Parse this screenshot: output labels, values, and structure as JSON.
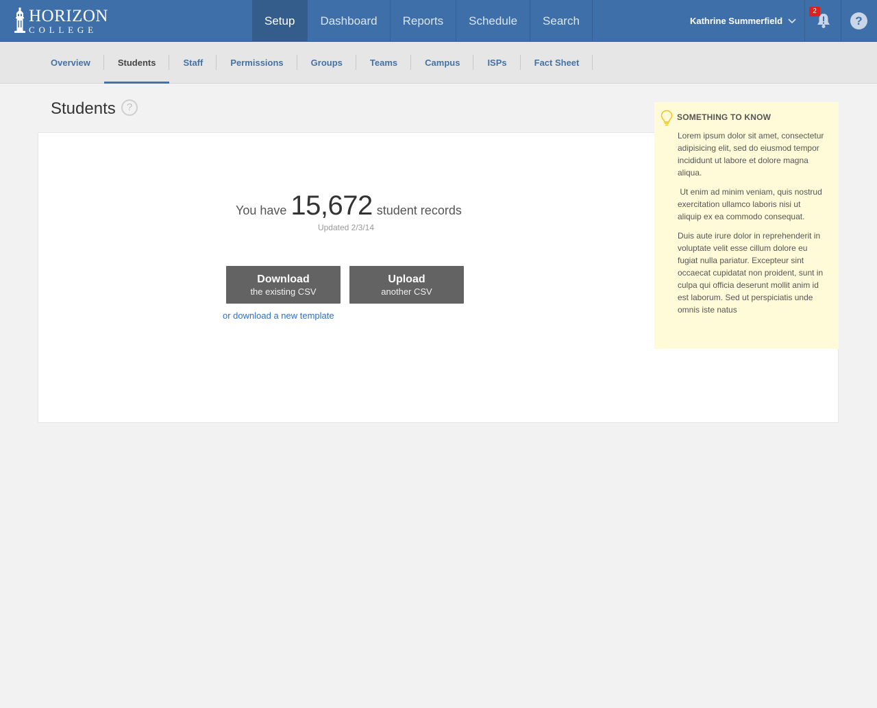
{
  "brand": {
    "line1": "HORIZON",
    "line2": "COLLEGE"
  },
  "main_nav": [
    {
      "label": "Setup",
      "active": true
    },
    {
      "label": "Dashboard",
      "active": false
    },
    {
      "label": "Reports",
      "active": false
    },
    {
      "label": "Schedule",
      "active": false
    },
    {
      "label": "Search",
      "active": false
    }
  ],
  "user": {
    "name": "Kathrine Summerfield",
    "icon": "chevron-down-icon"
  },
  "notifications": {
    "count": "2",
    "icon": "bell-icon"
  },
  "help": {
    "label": "?",
    "icon": "help-icon"
  },
  "sub_nav": [
    {
      "label": "Overview",
      "active": false
    },
    {
      "label": "Students",
      "active": true
    },
    {
      "label": "Staff",
      "active": false
    },
    {
      "label": "Permissions",
      "active": false
    },
    {
      "label": "Groups",
      "active": false
    },
    {
      "label": "Teams",
      "active": false
    },
    {
      "label": "Campus",
      "active": false
    },
    {
      "label": "ISPs",
      "active": false
    },
    {
      "label": "Fact Sheet",
      "active": false
    }
  ],
  "page": {
    "title": "Students",
    "help_label": "?",
    "records_pre": "You have",
    "records_count": "15,672",
    "records_post": "student records",
    "updated": "Updated 2/3/14",
    "download_btn": {
      "line1": "Download",
      "line2": "the existing CSV"
    },
    "upload_btn": {
      "line1": "Upload",
      "line2": "another CSV"
    },
    "template_link": "or download a new template"
  },
  "tip": {
    "icon": "lightbulb-icon",
    "heading": "SOMETHING TO KNOW",
    "paragraphs": [
      "Lorem ipsum dolor sit amet, consectetur adipisicing elit, sed do eiusmod tempor incididunt ut labore et dolore magna aliqua.",
      " Ut enim ad minim veniam, quis nostrud exercitation ullamco laboris nisi ut aliquip ex ea commodo consequat.",
      "Duis aute irure dolor in reprehenderit in voluptate velit esse cillum dolore eu fugiat nulla pariatur. Excepteur sint occaecat cupidatat non proident, sunt in culpa qui officia deserunt mollit anim id est laborum. Sed ut perspiciatis unde omnis iste natus"
    ]
  },
  "colors": {
    "topbar": "#3f6fa8",
    "accent_link": "#4372a6",
    "button": "#636363",
    "tip_bg": "#fffbd8",
    "badge": "#e02020"
  }
}
